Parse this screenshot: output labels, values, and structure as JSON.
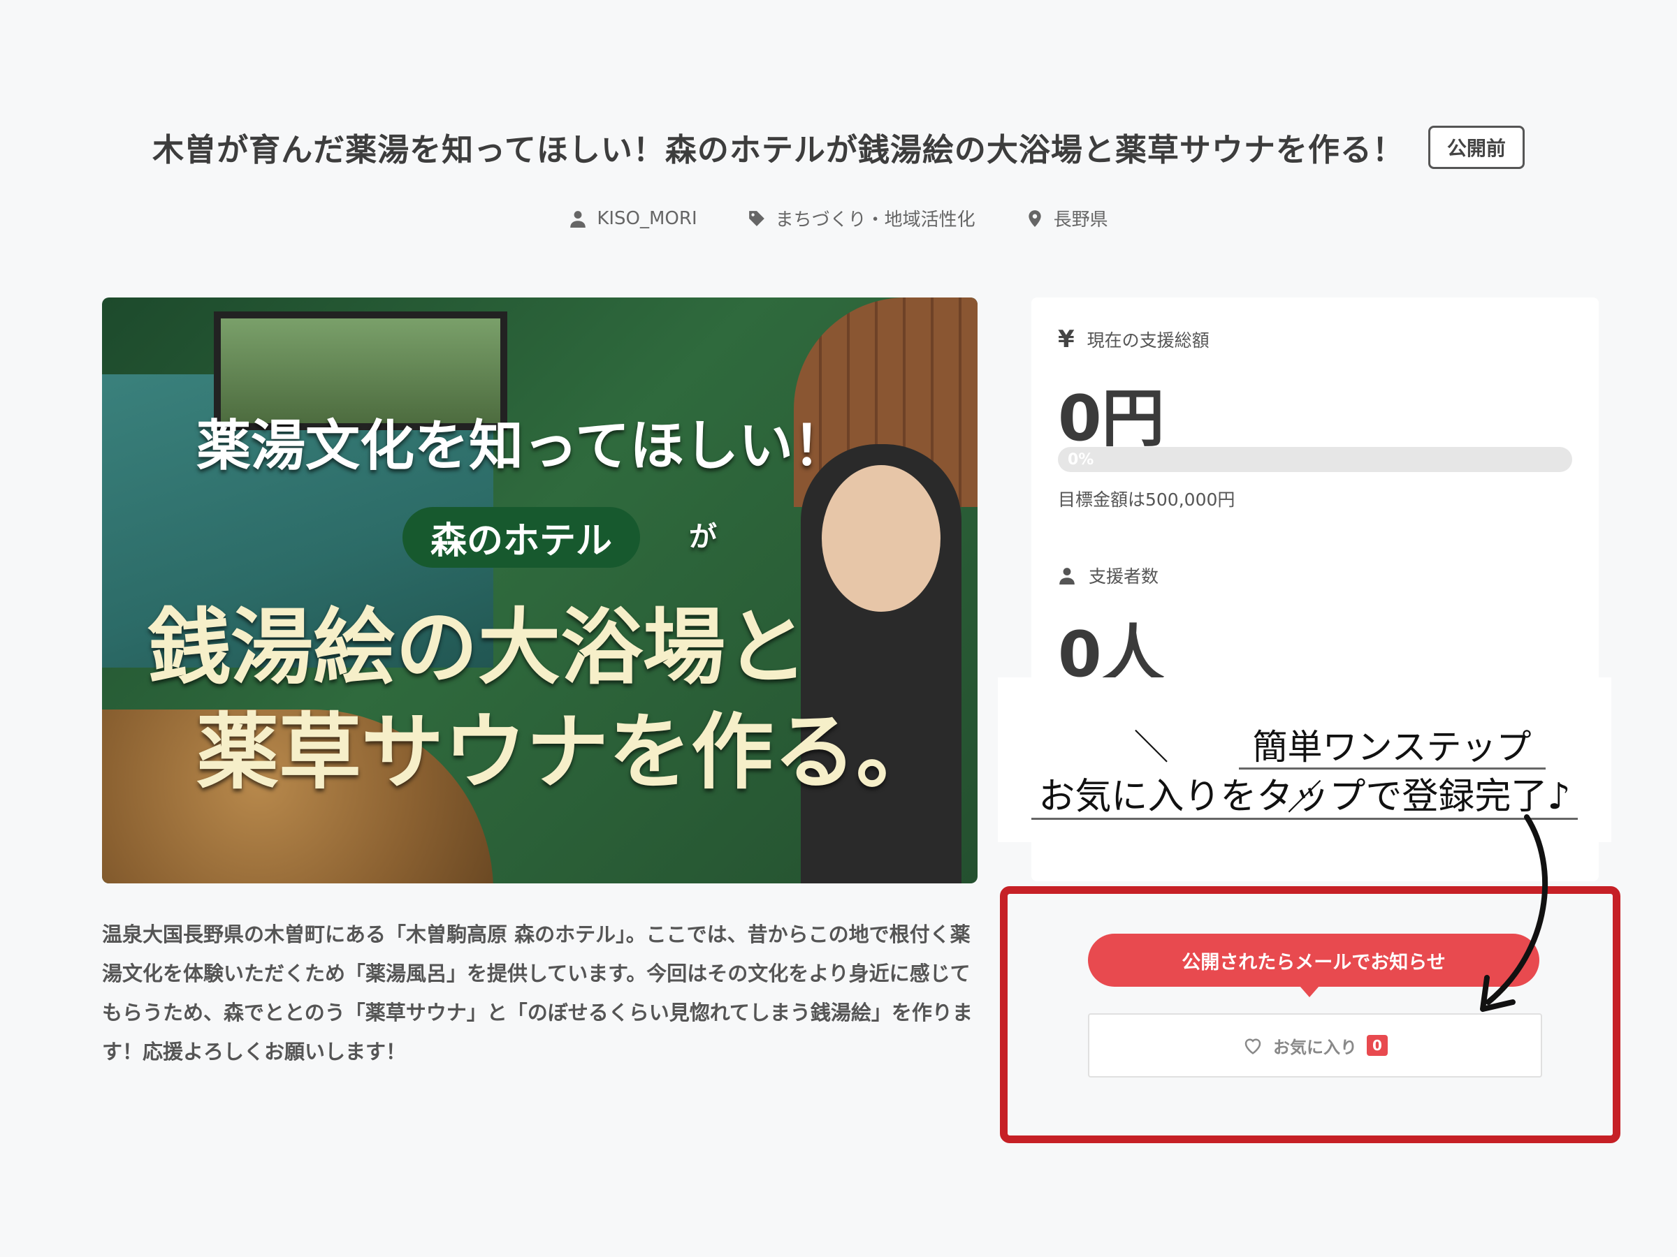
{
  "project": {
    "title": "木曽が育んだ薬湯を知ってほしい！森のホテルが銭湯絵の大浴場と薬草サウナを作る！",
    "status_badge": "公開前",
    "meta": {
      "author": "KISO_MORI",
      "category": "まちづくり・地域活性化",
      "location": "長野県"
    },
    "hero": {
      "line1": "薬湯文化を知ってほしい！",
      "pill": "森のホテル",
      "ga": "が",
      "line3": "銭湯絵の大浴場と",
      "line4": "薬草サウナを作る。"
    },
    "description": "温泉大国長野県の木曽町にある「木曽駒高原 森のホテル」。ここでは、昔からこの地で根付く薬湯文化を体験いただくため「薬湯風呂」を提供しています。今回はその文化をより身近に感じてもらうため、森でととのう「薬草サウナ」と「のぼせるくらい見惚れてしまう銭湯絵」を作ります！応援よろしくお願いします！"
  },
  "stats": {
    "yen_symbol": "¥",
    "total_label": "現在の支援総額",
    "total_value": "0円",
    "progress_percent": 0,
    "progress_text": "0%",
    "goal_text": "目標金額は500,000円",
    "supporters_label": "支援者数",
    "supporters_value": "0人"
  },
  "callout": {
    "slash_left": "＼",
    "line1": "簡単ワンステップ",
    "slash_right": "／",
    "line2": "お気に入りをタップで登録完了♪"
  },
  "actions": {
    "notify_label": "公開されたらメールでお知らせ",
    "favorite_label": "お気に入り",
    "favorite_count": "0"
  },
  "colors": {
    "accent": "#e84a4f",
    "frame": "#c62026",
    "background": "#f7f8f9"
  },
  "icons": [
    "user-icon",
    "tag-icon",
    "location-pin-icon",
    "yen-icon",
    "users-icon",
    "heart-icon",
    "arrow-icon"
  ]
}
